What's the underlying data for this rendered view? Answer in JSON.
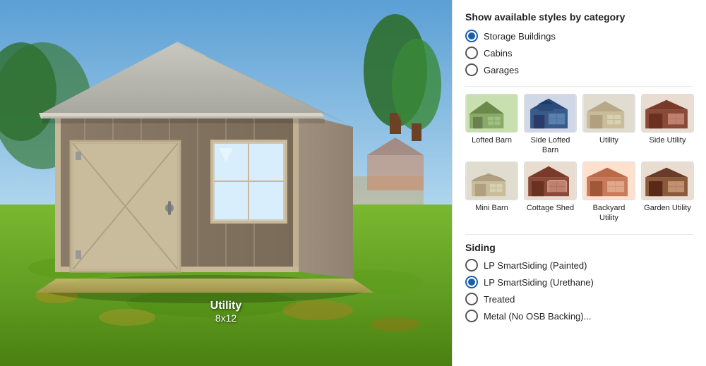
{
  "left": {
    "building_name": "Utility",
    "building_size": "8x12"
  },
  "right": {
    "category_title": "Show available styles by category",
    "categories": [
      {
        "id": "storage",
        "label": "Storage Buildings",
        "selected": true
      },
      {
        "id": "cabins",
        "label": "Cabins",
        "selected": false
      },
      {
        "id": "garages",
        "label": "Garages",
        "selected": false
      }
    ],
    "styles": [
      {
        "id": "lofted-barn",
        "name": "Lofted Barn",
        "color1": "#8aaa6a",
        "color2": "#6a8a4a"
      },
      {
        "id": "side-lofted-barn",
        "name": "Side Lofted\nBarn",
        "color1": "#3a5a8a",
        "color2": "#2a4a7a"
      },
      {
        "id": "utility",
        "name": "Utility",
        "color1": "#c8bc9a",
        "color2": "#b8a888"
      },
      {
        "id": "side-utility",
        "name": "Side Utility",
        "color1": "#8a4a3a",
        "color2": "#7a3a2a"
      },
      {
        "id": "mini-barn",
        "name": "Mini Barn",
        "color1": "#c8bc9a",
        "color2": "#b8a888"
      },
      {
        "id": "cottage-shed",
        "name": "Cottage\nShed",
        "color1": "#8a4a3a",
        "color2": "#7a3a2a"
      },
      {
        "id": "backyard-utility",
        "name": "Backyard\nUtility",
        "color1": "#c87a5a",
        "color2": "#b86a4a"
      },
      {
        "id": "garden-utility",
        "name": "Garden\nUtility",
        "color1": "#8a4a3a",
        "color2": "#6a3a2a"
      }
    ],
    "siding_title": "Siding",
    "siding_options": [
      {
        "id": "lp-painted",
        "label": "LP SmartSiding (Painted)",
        "selected": false
      },
      {
        "id": "lp-urethane",
        "label": "LP SmartSiding (Urethane)",
        "selected": true
      },
      {
        "id": "treated",
        "label": "Treated",
        "selected": false
      },
      {
        "id": "metal",
        "label": "Metal (No OSB Backing)...",
        "selected": false
      }
    ]
  }
}
